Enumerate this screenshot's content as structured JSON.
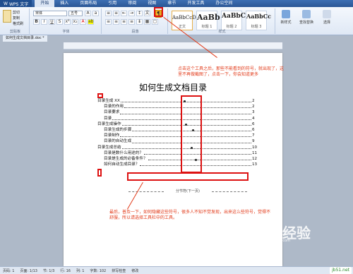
{
  "app": {
    "name": "WPS 文字"
  },
  "menu": [
    "开始",
    "插入",
    "页面布局",
    "引用",
    "审阅",
    "视图",
    "章节",
    "开发工具",
    "办公空间"
  ],
  "ribbon": {
    "font_name": "宋体",
    "font_size": "五号",
    "clipboard": {
      "cut": "剪切",
      "copy": "复制",
      "format_painter": "格式刷",
      "label": "剪贴板"
    },
    "font_label": "字体",
    "paragraph_label": "段落",
    "styles": [
      {
        "preview": "AaBbCcDd",
        "caption": "正文"
      },
      {
        "preview": "AaBb",
        "caption": "标题 1"
      },
      {
        "preview": "AaBbC",
        "caption": "标题 2"
      },
      {
        "preview": "AaBbCc",
        "caption": "标题 3"
      }
    ],
    "styles_label": "样式",
    "new_style": "新样式",
    "find_replace": "查找替换",
    "select": "选择",
    "pilcrow": "¶"
  },
  "tab": {
    "title": "如何生成文档目录.doc *"
  },
  "document": {
    "title": "如何生成文档目录",
    "toc": [
      {
        "text": "目录生成 XX",
        "page": "2",
        "level": 1
      },
      {
        "text": "目录的作用",
        "page": "2",
        "level": 2
      },
      {
        "text": "目录要求",
        "page": "3",
        "level": 2
      },
      {
        "text": "目录",
        "page": "4",
        "level": 2
      },
      {
        "text": "目录生成操作",
        "page": "6",
        "level": 1
      },
      {
        "text": "目录生成的步骤",
        "page": "6",
        "level": 2
      },
      {
        "text": "目录制作",
        "page": "7",
        "level": 2
      },
      {
        "text": "目录的自动生成",
        "page": "9",
        "level": 2
      },
      {
        "text": "目录生成总结",
        "page": "10",
        "level": 1
      },
      {
        "text": "目录是数什么用途的？",
        "page": "11",
        "level": 2
      },
      {
        "text": "目录是生成的必备条件？",
        "page": "12",
        "level": 2
      },
      {
        "text": "如何自动生成目录？",
        "page": "13",
        "level": 2
      }
    ],
    "section_break": "分节符(下一页)"
  },
  "annotations": {
    "top": "点击这个工具之后，那些不能看到的符号，就出现了，这里不再做截图了，点击一下，你会知道更多",
    "bottom": "最后，普及一下，如何隐藏这些符号，很多人不知不觉发现，出来这么些符号，觉得不舒服，所以请选择工具栏中的工具。"
  },
  "status": [
    "页码: 1",
    "页面: 1/13",
    "节: 1/3",
    "行: 16",
    "列: 1",
    "字数: 102",
    "拼写检查",
    "修改"
  ],
  "watermark": {
    "text": "Baidu 经验",
    "sub": "jingyan.baidu.com"
  },
  "brand_tag": "jb51.net"
}
